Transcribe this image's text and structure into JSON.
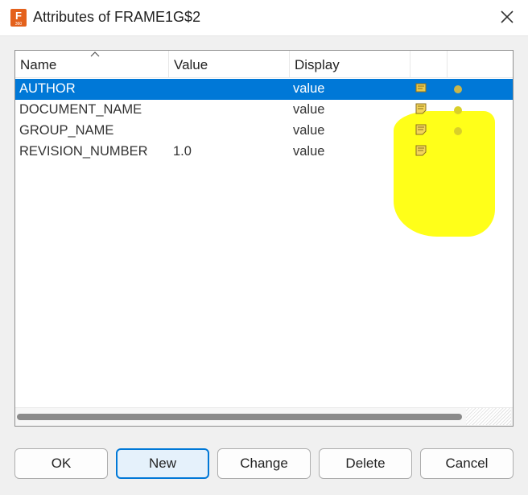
{
  "window": {
    "title": "Attributes of FRAME1G$2",
    "app_icon_letter": "F",
    "app_icon_subtext": "360"
  },
  "table": {
    "columns": [
      "Name",
      "Value",
      "Display"
    ],
    "sorted_by": "Name",
    "rows": [
      {
        "name": "AUTHOR",
        "value": "",
        "display": "value",
        "selected": true
      },
      {
        "name": "DOCUMENT_NAME",
        "value": "",
        "display": "value",
        "selected": false
      },
      {
        "name": "GROUP_NAME",
        "value": "",
        "display": "value",
        "selected": false
      },
      {
        "name": "REVISION_NUMBER",
        "value": "1.0",
        "display": "value",
        "selected": false
      }
    ],
    "row_icons": [
      "note-icon",
      "dot-icon"
    ]
  },
  "buttons": {
    "ok": "OK",
    "new": "New",
    "change": "Change",
    "delete": "Delete",
    "cancel": "Cancel"
  },
  "colors": {
    "selection": "#0078d7",
    "highlight": "#ffff00",
    "default_button_border": "#0078d7",
    "app_icon": "#e4611c"
  }
}
